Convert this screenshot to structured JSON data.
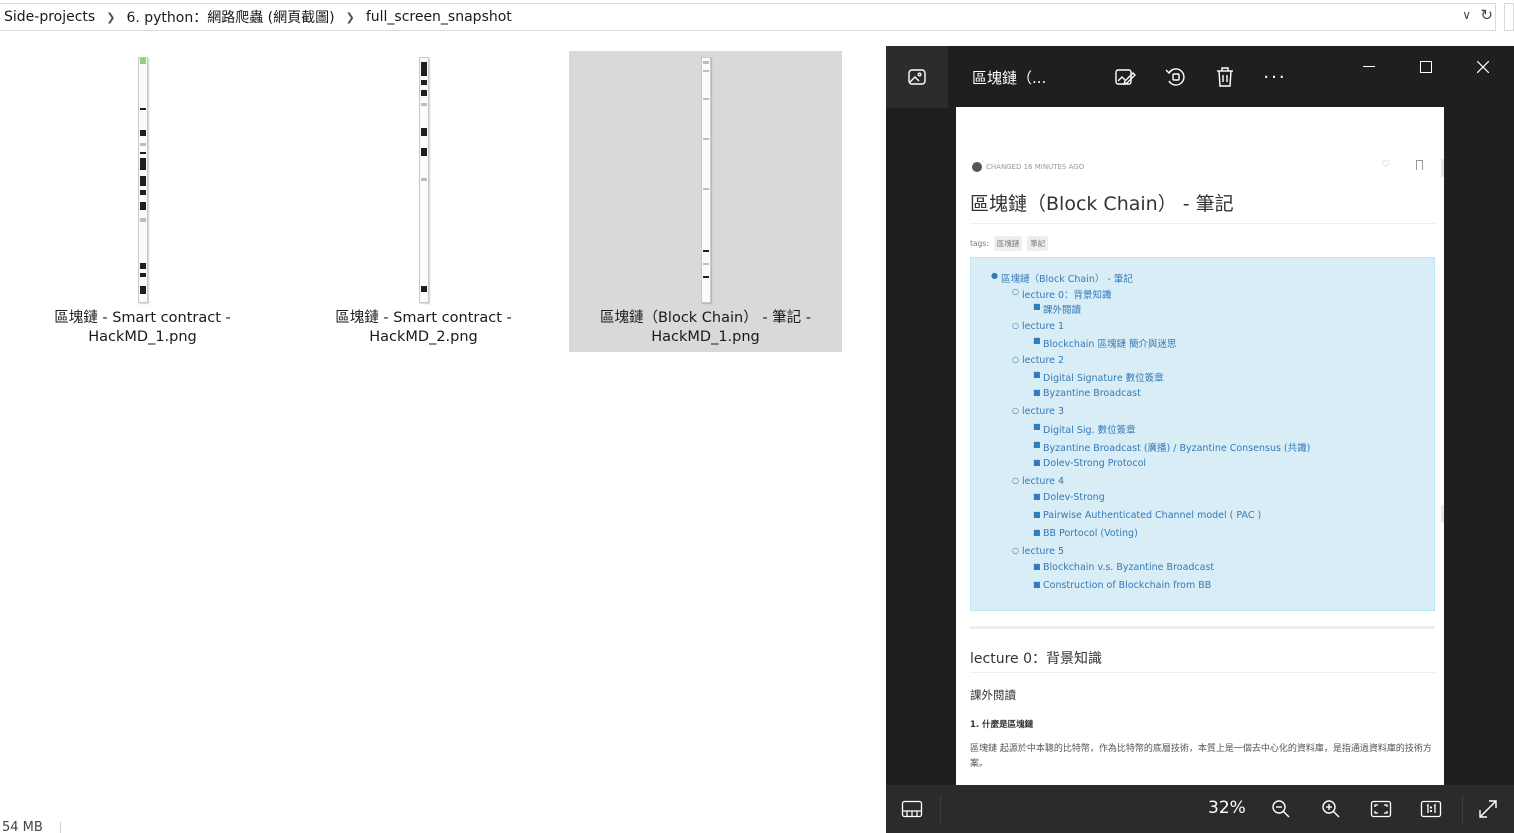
{
  "explorer": {
    "breadcrumb": [
      "Side-projects",
      "6. python：網路爬蟲 (網頁截圖)",
      "full_screen_snapshot"
    ],
    "files": [
      {
        "name_line1": "區塊鏈 - Smart contract -",
        "name_line2": "HackMD_1.png",
        "selected": false
      },
      {
        "name_line1": "區塊鏈 - Smart contract -",
        "name_line2": "HackMD_2.png",
        "selected": false
      },
      {
        "name_line1": "區塊鏈（Block Chain） - 筆記 -",
        "name_line2": "HackMD_1.png",
        "selected": true
      }
    ],
    "status_text": "54 MB"
  },
  "viewer": {
    "title": "區塊鏈（...",
    "toolbar_icons": [
      "edit-image-icon",
      "rotate-icon",
      "delete-icon",
      "more-icon"
    ],
    "window_icons": [
      "minimize-icon",
      "maximize-icon",
      "close-icon"
    ],
    "zoom": "32%",
    "document": {
      "meta": "CHANGED 16 MINUTES AGO",
      "title": "區塊鏈（Block Chain） - 筆記",
      "tags_label": "tags:",
      "tags": [
        "區塊鏈",
        "筆記"
      ],
      "toc": [
        {
          "text": "區塊鏈（Block Chain） - 筆記",
          "level": 1
        },
        {
          "text": "lecture 0：背景知識",
          "level": 2
        },
        {
          "text": "課外閱讀",
          "level": 3
        },
        {
          "text": "lecture 1",
          "level": 2
        },
        {
          "text": "Blockchain 區塊鏈 簡介與迷思",
          "level": 3
        },
        {
          "text": "lecture 2",
          "level": 2
        },
        {
          "text": "Digital Signature 數位簽章",
          "level": 3
        },
        {
          "text": "Byzantine Broadcast",
          "level": 3
        },
        {
          "text": "lecture 3",
          "level": 2
        },
        {
          "text": "Digital Sig. 數位簽章",
          "level": 3
        },
        {
          "text": "Byzantine Broadcast (廣播) / Byzantine Consensus (共識)",
          "level": 3
        },
        {
          "text": "Dolev-Strong Protocol",
          "level": 3
        },
        {
          "text": "lecture 4",
          "level": 2
        },
        {
          "text": "Dolev-Strong",
          "level": 3
        },
        {
          "text": "Pairwise Authenticated Channel model ( PAC )",
          "level": 3
        },
        {
          "text": "BB Portocol (Voting)",
          "level": 3
        },
        {
          "text": "lecture 5",
          "level": 2
        },
        {
          "text": "Blockchain v.s. Byzantine Broadcast",
          "level": 3
        },
        {
          "text": "Construction of Blockchain from BB",
          "level": 3
        }
      ],
      "section_heading": "lecture 0：背景知識",
      "sub_heading": "課外閱讀",
      "item_heading": "1. 什麼是區塊鏈",
      "paragraph": "區塊鏈 起源於中本聰的比特幣，作為比特幣的底層技術，本質上是一個去中心化的資料庫，是指通過資料庫的技術方案。"
    }
  }
}
